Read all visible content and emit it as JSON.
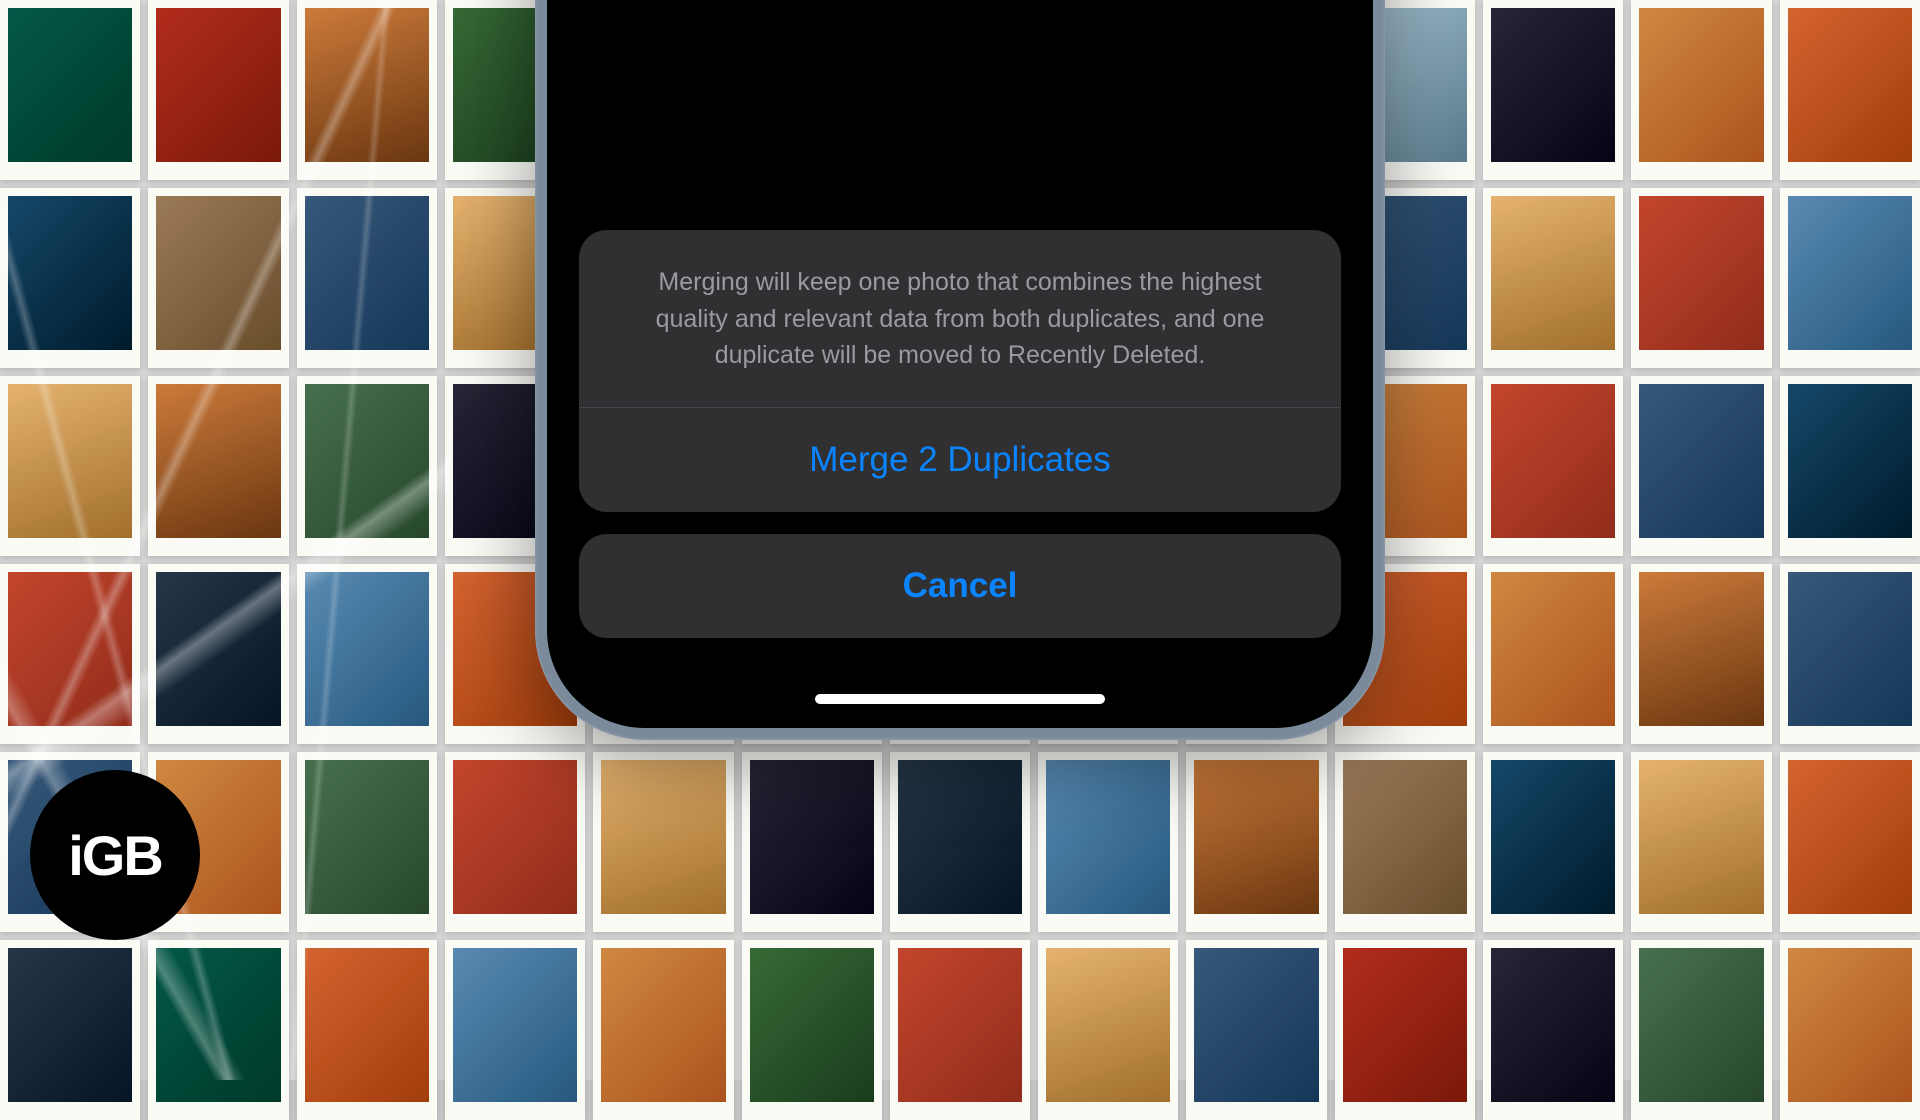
{
  "dialog": {
    "message": "Merging will keep one photo that combines the highest quality and relevant data from both duplicates, and one duplicate will be moved to Recently Deleted.",
    "merge_label": "Merge 2 Duplicates",
    "cancel_label": "Cancel"
  },
  "badge": {
    "text": "iGB"
  },
  "colors": {
    "ios_blue": "#0a84ff",
    "sheet_bg": "#323235",
    "sheet_text_muted": "#9a9a9f"
  }
}
